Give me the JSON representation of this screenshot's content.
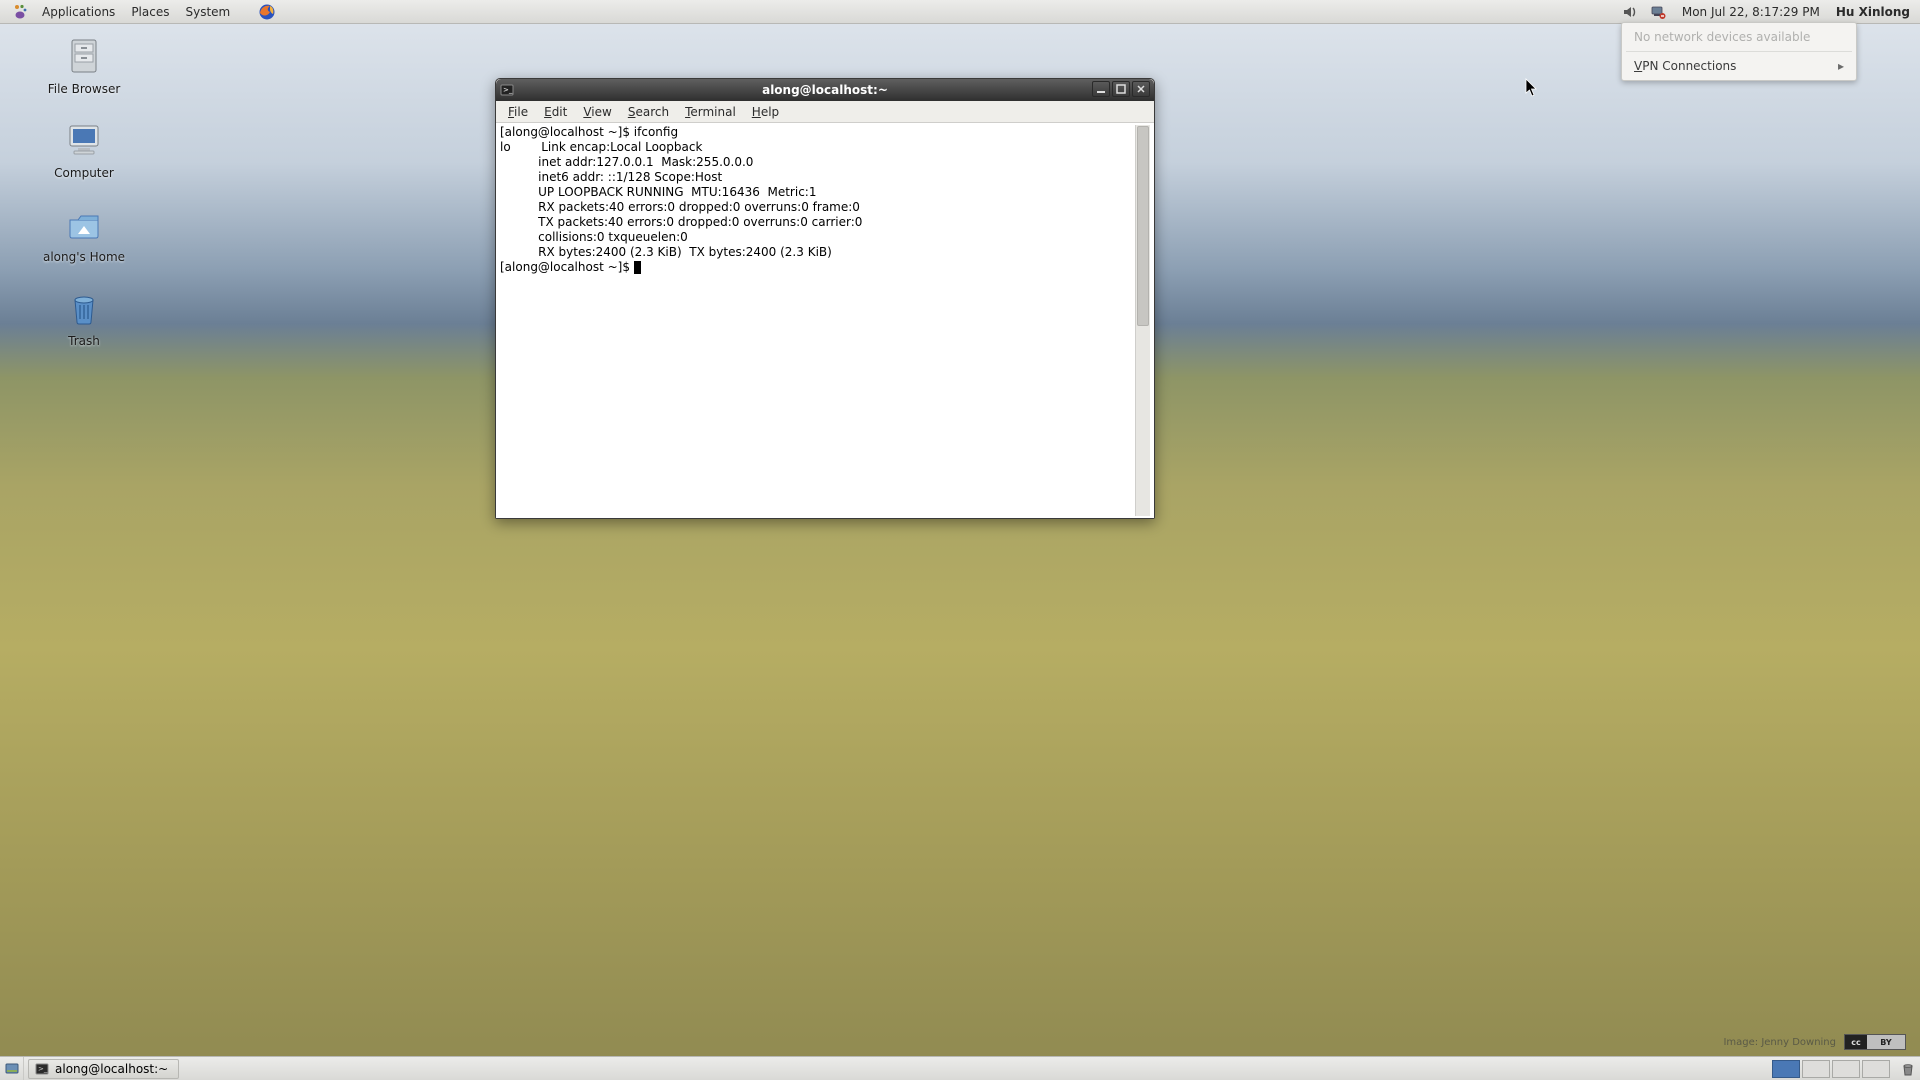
{
  "top_panel": {
    "menus": {
      "applications": "Applications",
      "places": "Places",
      "system": "System"
    },
    "clock": "Mon Jul 22,  8:17:29 PM",
    "user": "Hu Xinlong"
  },
  "net_popup": {
    "no_devices": "No network devices available",
    "vpn": "VPN Connections"
  },
  "desktop": {
    "file_browser": "File Browser",
    "computer": "Computer",
    "home": "along's Home",
    "trash": "Trash"
  },
  "terminal": {
    "title": "along@localhost:~",
    "menus": {
      "file": "File",
      "edit": "Edit",
      "view": "View",
      "search": "Search",
      "terminal": "Terminal",
      "help": "Help"
    },
    "lines": [
      "[along@localhost ~]$ ifconfig",
      "lo        Link encap:Local Loopback  ",
      "          inet addr:127.0.0.1  Mask:255.0.0.0",
      "          inet6 addr: ::1/128 Scope:Host",
      "          UP LOOPBACK RUNNING  MTU:16436  Metric:1",
      "          RX packets:40 errors:0 dropped:0 overruns:0 frame:0",
      "          TX packets:40 errors:0 dropped:0 overruns:0 carrier:0",
      "          collisions:0 txqueuelen:0 ",
      "          RX bytes:2400 (2.3 KiB)  TX bytes:2400 (2.3 KiB)",
      "",
      "[along@localhost ~]$ "
    ]
  },
  "taskbar": {
    "task1": "along@localhost:~"
  },
  "credit": {
    "text": "Image: Jenny Downing",
    "cc": "cc",
    "by": "BY"
  }
}
